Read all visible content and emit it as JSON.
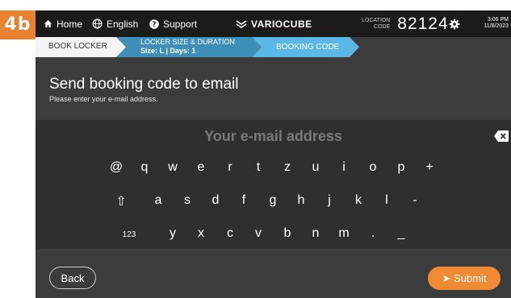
{
  "step_badge": "4b",
  "topbar": {
    "home_label": "Home",
    "language_label": "English",
    "support_label": "Support",
    "brand": "VARIOCUBE",
    "location_label_line1": "LOCATION",
    "location_label_line2": "CODE",
    "location_code": "82124",
    "time": "3:06 PM",
    "date": "11/8/2023"
  },
  "breadcrumb": {
    "step1": "BOOK LOCKER",
    "step2_line1": "LOCKER SIZE & DURATION",
    "step2_line2": "Size: L | Days: 1",
    "step3": "BOOKING CODE"
  },
  "page": {
    "title": "Send booking code to email",
    "subtitle": "Please enter your e-mail address."
  },
  "email_field": {
    "placeholder": "Your e-mail address"
  },
  "keyboard": {
    "row1": [
      "@",
      "q",
      "w",
      "e",
      "r",
      "t",
      "z",
      "u",
      "i",
      "o",
      "p",
      "+"
    ],
    "row2": [
      "⇧",
      "a",
      "s",
      "d",
      "f",
      "g",
      "h",
      "j",
      "k",
      "l",
      "-"
    ],
    "row3": [
      "123",
      "y",
      "x",
      "c",
      "v",
      "b",
      "n",
      "m",
      ".",
      "_"
    ]
  },
  "actions": {
    "back_label": "Back",
    "submit_label": "➤ Submit"
  },
  "colors": {
    "accent": "#f08a33",
    "active_step": "#5bb8e6",
    "mid_step": "#3d8fb8",
    "background": "#3c3c3c",
    "keyboard_bg": "#2f2f2f"
  }
}
